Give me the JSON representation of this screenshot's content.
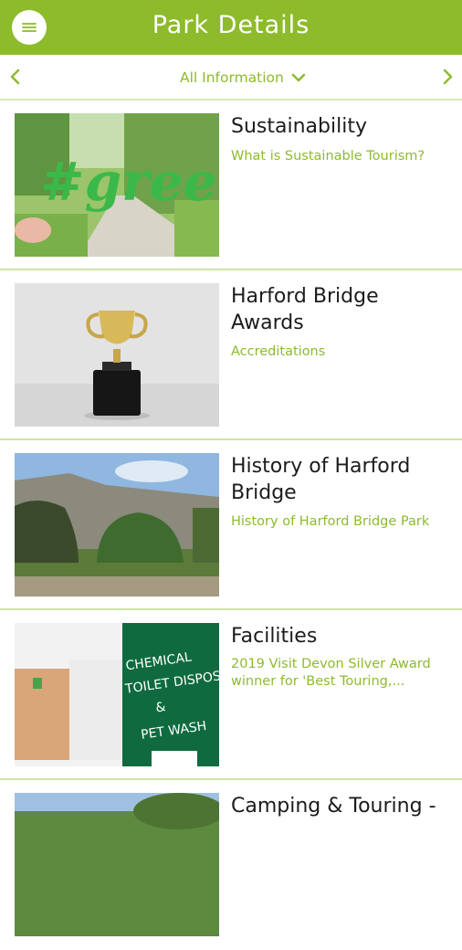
{
  "header": {
    "title": "Park Details",
    "menu_icon": "hamburger-icon"
  },
  "filter": {
    "selected": "All Information",
    "prev_icon": "chevron-left-icon",
    "next_icon": "chevron-right-icon"
  },
  "colors": {
    "accent": "#8dbb2c",
    "divider": "#cfe3a5"
  },
  "items": [
    {
      "title": "Sustainability",
      "subtitle": "What is Sustainable Tourism?",
      "image_text": "#green"
    },
    {
      "title": "Harford Bridge Awards",
      "subtitle": "Accreditations"
    },
    {
      "title": "History of Harford Bridge",
      "subtitle": "History of Harford Bridge Park"
    },
    {
      "title": "Facilities",
      "subtitle": "2019 Visit Devon Silver Award winner for 'Best Touring,...",
      "image_text": [
        "CHEMICAL",
        "TOILET DISPOS",
        "&",
        "PET WASH"
      ]
    },
    {
      "title": "Camping & Touring -"
    }
  ]
}
